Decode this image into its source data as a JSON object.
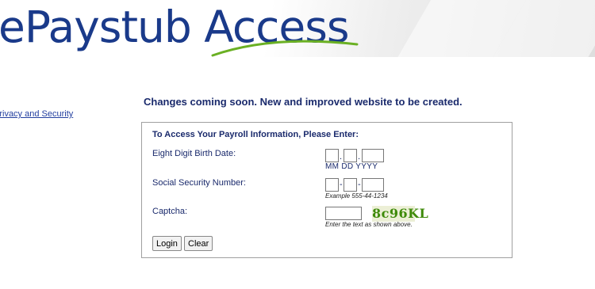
{
  "header": {
    "logo_text": "ePaystub Access"
  },
  "sidebar": {
    "privacy_link": "Privacy and Security"
  },
  "notice": "Changes coming soon. New and improved website to be created.",
  "form": {
    "heading": "To Access Your Payroll Information, Please Enter:",
    "birth_date": {
      "label": "Eight Digit Birth Date:",
      "separator": ".",
      "format_hint": "MM DD YYYY",
      "month_value": "",
      "day_value": "",
      "year_value": ""
    },
    "ssn": {
      "label": "Social Security Number:",
      "separator": "-",
      "example": "Example 555-44-1234",
      "part1_value": "",
      "part2_value": "",
      "part3_value": ""
    },
    "captcha": {
      "label": "Captcha:",
      "code": "8c96KL",
      "hint": "Enter the text as shown above.",
      "input_value": ""
    },
    "buttons": {
      "login": "Login",
      "clear": "Clear"
    }
  },
  "colors": {
    "text": "#1a2a6c",
    "logo": "#1a3a8a",
    "swoosh": "#6ab023",
    "captcha": "#3e8a0a"
  }
}
